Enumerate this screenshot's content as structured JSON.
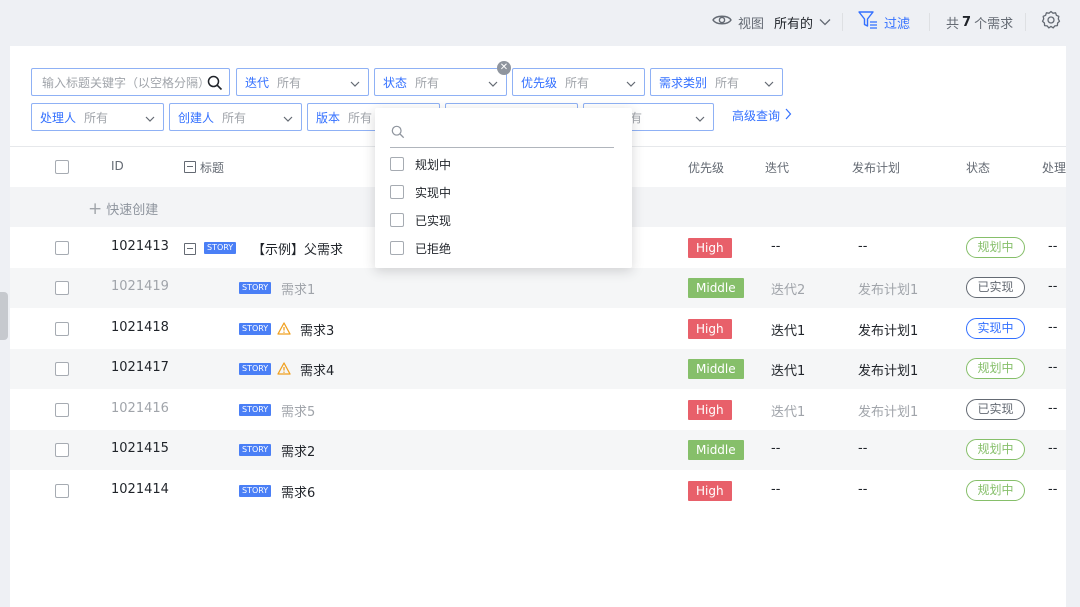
{
  "topbar": {
    "view_label": "视图",
    "view_value": "所有的",
    "filter_label": "过滤",
    "count_prefix": "共",
    "count_value": "7",
    "count_suffix": "个需求"
  },
  "search": {
    "placeholder": "输入标题关键字（以空格分隔）"
  },
  "filters": [
    {
      "label": "迭代",
      "value": "所有"
    },
    {
      "label": "状态",
      "value": "所有"
    },
    {
      "label": "优先级",
      "value": "所有"
    },
    {
      "label": "需求类别",
      "value": "所有"
    },
    {
      "label": "处理人",
      "value": "所有"
    },
    {
      "label": "创建人",
      "value": "所有"
    },
    {
      "label": "版本",
      "value": "所有"
    },
    {
      "label": "",
      "value": "有"
    }
  ],
  "advanced_query": "高级查询",
  "dropdown": {
    "options": [
      "规划中",
      "实现中",
      "已实现",
      "已拒绝"
    ]
  },
  "table": {
    "headers": {
      "id": "ID",
      "title": "标题",
      "priority": "优先级",
      "iteration": "迭代",
      "release_plan": "发布计划",
      "status": "状态",
      "handler": "处理"
    },
    "quick_create": "快速创建",
    "story_badge": "STORY",
    "rows": [
      {
        "id": "1021413",
        "title": "【示例】父需求",
        "priority": "High",
        "iteration": "--",
        "plan": "--",
        "status": "规划中",
        "handler": "--"
      },
      {
        "id": "1021419",
        "title": "需求1",
        "priority": "Middle",
        "iteration": "迭代2",
        "plan": "发布计划1",
        "status": "已实现",
        "handler": "--"
      },
      {
        "id": "1021418",
        "title": "需求3",
        "priority": "High",
        "iteration": "迭代1",
        "plan": "发布计划1",
        "status": "实现中",
        "handler": "--"
      },
      {
        "id": "1021417",
        "title": "需求4",
        "priority": "Middle",
        "iteration": "迭代1",
        "plan": "发布计划1",
        "status": "规划中",
        "handler": "--"
      },
      {
        "id": "1021416",
        "title": "需求5",
        "priority": "High",
        "iteration": "迭代1",
        "plan": "发布计划1",
        "status": "已实现",
        "handler": "--"
      },
      {
        "id": "1021415",
        "title": "需求2",
        "priority": "Middle",
        "iteration": "--",
        "plan": "--",
        "status": "规划中",
        "handler": "--"
      },
      {
        "id": "1021414",
        "title": "需求6",
        "priority": "High",
        "iteration": "--",
        "plan": "--",
        "status": "规划中",
        "handler": "--"
      }
    ]
  },
  "colors": {
    "accent": "#3370ff",
    "priority_high": "#e8606a",
    "priority_middle": "#86bf6a",
    "status_planning": "#86bf6a",
    "status_in_progress": "#3370ff",
    "status_done": "#646a73"
  }
}
